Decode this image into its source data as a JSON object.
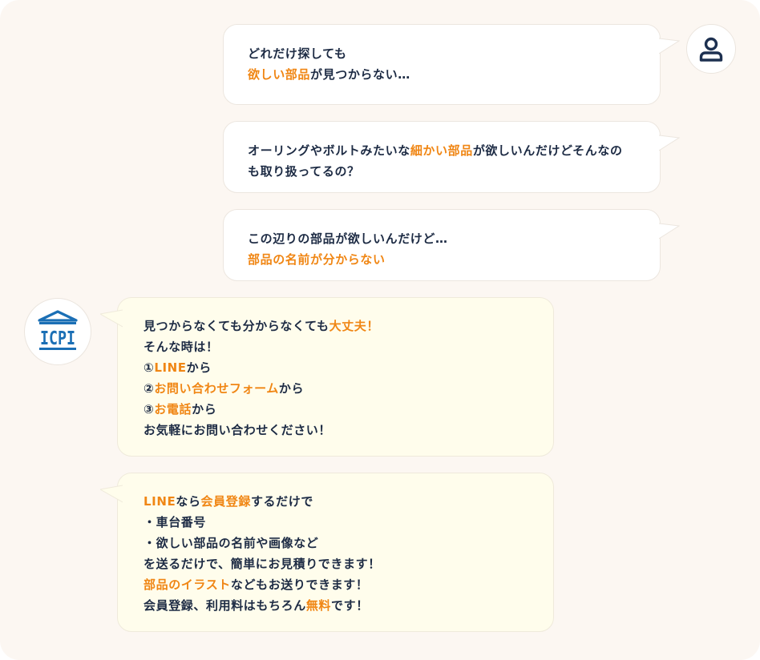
{
  "user_messages": [
    {
      "lines": [
        [
          {
            "t": "どれだけ探しても"
          }
        ],
        [
          {
            "t": "欲しい部品",
            "hl": true
          },
          {
            "t": "が見つからない…"
          }
        ]
      ]
    },
    {
      "lines": [
        [
          {
            "t": "オーリングやボルトみたいな"
          },
          {
            "t": "細かい部品",
            "hl": true
          },
          {
            "t": "が欲しいんだけどそんなの"
          }
        ],
        [
          {
            "t": "も取り扱ってるの？"
          }
        ]
      ]
    },
    {
      "lines": [
        [
          {
            "t": "この辺りの部品が欲しいんだけど…"
          }
        ],
        [
          {
            "t": "部品の名前が分からない",
            "hl": true
          }
        ]
      ]
    }
  ],
  "shop_messages": [
    {
      "lines": [
        [
          {
            "t": "見つからなくても分からなくても"
          },
          {
            "t": "大丈夫！",
            "hl": true
          }
        ],
        [
          {
            "t": "そんな時は！"
          }
        ],
        [
          {
            "t": "①"
          },
          {
            "t": "LINE",
            "hl": true
          },
          {
            "t": "から"
          }
        ],
        [
          {
            "t": "②"
          },
          {
            "t": "お問い合わせフォーム",
            "hl": true
          },
          {
            "t": "から"
          }
        ],
        [
          {
            "t": "③"
          },
          {
            "t": "お電話",
            "hl": true
          },
          {
            "t": "から"
          }
        ],
        [
          {
            "t": "お気軽にお問い合わせください！"
          }
        ]
      ]
    },
    {
      "lines": [
        [
          {
            "t": "LINE",
            "hl": true
          },
          {
            "t": "なら"
          },
          {
            "t": "会員登録",
            "hl": true
          },
          {
            "t": "するだけで"
          }
        ],
        [
          {
            "t": "・車台番号"
          }
        ],
        [
          {
            "t": "・欲しい部品の名前や画像など"
          }
        ],
        [
          {
            "t": "を送るだけで、簡単にお見積りできます！"
          }
        ],
        [
          {
            "t": "部品のイラスト",
            "hl": true
          },
          {
            "t": "などもお送りできます！"
          }
        ],
        [
          {
            "t": "会員登録、利用料はもちろん"
          },
          {
            "t": "無料",
            "hl": true
          },
          {
            "t": "です！"
          }
        ]
      ]
    }
  ],
  "logo": {
    "text": "ICPI"
  },
  "icons": {
    "user": "user-icon",
    "shop": "icpi-logo-icon"
  },
  "colors": {
    "highlight": "#f08614",
    "text": "#1d2b44",
    "logo": "#1b6fb5",
    "user_bubble": "#ffffff",
    "shop_bubble": "#fffdec",
    "panel": "#fcf7f2"
  }
}
